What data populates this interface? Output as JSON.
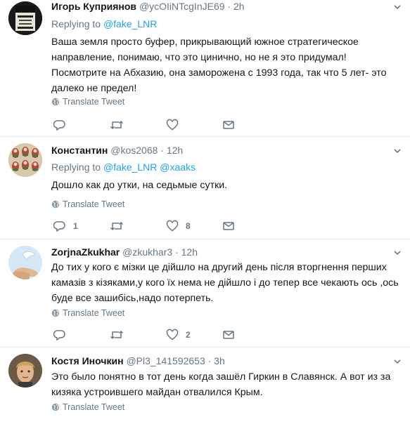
{
  "colors": {
    "link": "#1da1f2",
    "muted": "#657786",
    "text": "#14171a",
    "border": "#e6ecf0"
  },
  "tweets": [
    {
      "name": "Игорь Куприянов",
      "handle": "@ycOIiNTcgInJE69",
      "time": "2h",
      "replying_prefix": "Replying to",
      "mentions": [
        "@fake_LNR"
      ],
      "text": "Ваша земля просто буфер, прикрывающий южное стратегическое направление, понимаю, что это цинично, но не я это придумал! Посмотрите на Абхазию, она заморожена с 1993 года, так что 5 лет- это далеко не предел!",
      "translate": "Translate Tweet",
      "replies": "",
      "retweets": "",
      "likes": ""
    },
    {
      "name": "Константин",
      "handle": "@kos2068",
      "time": "12h",
      "replying_prefix": "Replying to",
      "mentions": [
        "@fake_LNR",
        "@xaaks"
      ],
      "text": "Дошло как до утки, на седьмые сутки.",
      "translate": "Translate Tweet",
      "replies": "1",
      "retweets": "",
      "likes": "8"
    },
    {
      "name": "ZorjnaZkukhar",
      "handle": "@zkukhar3",
      "time": "12h",
      "text": "До тих у кого є мізки це дійшло на другий день після вторгнення перших камазів з кізяками,у кого їх нема не дійшло і до тепер все чекають ось ,ось буде все зашибісь,надо потерпеть.",
      "translate": "Translate Tweet",
      "replies": "",
      "retweets": "",
      "likes": "2"
    },
    {
      "name": "Костя Иночкин",
      "handle": "@Pl3_141592653",
      "time": "3h",
      "text": "Это было понятно в тот день когда зашёл Гиркин в Славянск. А вот из за кизяка устроившего майдан отвалился Крым.",
      "translate": "Translate Tweet"
    }
  ],
  "separator": "·",
  "icons": [
    "reply-icon",
    "retweet-icon",
    "like-icon",
    "message-icon",
    "globe-icon",
    "chevron-down-icon"
  ]
}
